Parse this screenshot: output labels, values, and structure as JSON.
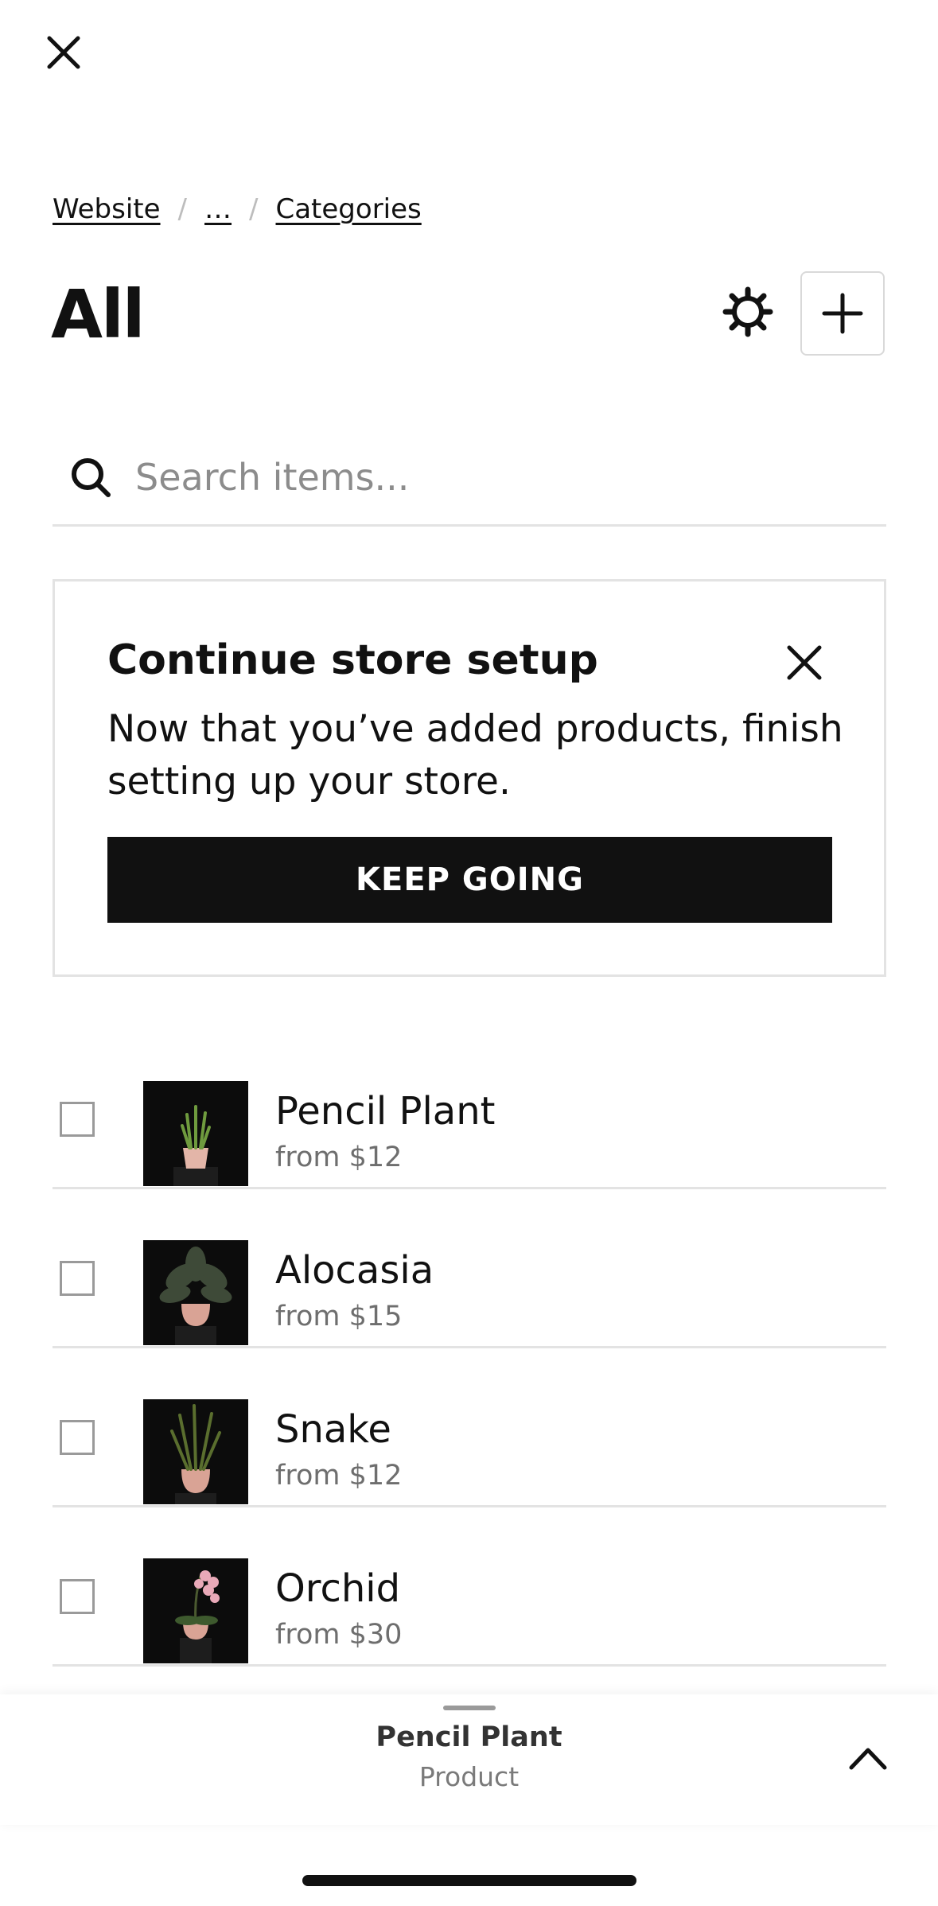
{
  "breadcrumb": {
    "items": [
      "Website",
      "…",
      "Categories"
    ],
    "separator": "/"
  },
  "header": {
    "title": "All"
  },
  "search": {
    "placeholder": "Search items..."
  },
  "setup_card": {
    "title": "Continue store setup",
    "body": "Now that you’ve added products, finish setting up your store.",
    "button_label": "KEEP GOING"
  },
  "products": [
    {
      "name": "Pencil Plant",
      "price": "from $12"
    },
    {
      "name": "Alocasia",
      "price": "from $15"
    },
    {
      "name": "Snake",
      "price": "from $12"
    },
    {
      "name": "Orchid",
      "price": "from $30"
    }
  ],
  "peek": {
    "title": "Pencil Plant",
    "subtitle": "Product"
  },
  "icons": [
    "close-icon",
    "gear-icon",
    "plus-icon",
    "search-icon",
    "chevron-up-icon"
  ],
  "colors": {
    "primary": "#111111",
    "border": "#e3e3e3",
    "muted": "#6e6e6e"
  }
}
